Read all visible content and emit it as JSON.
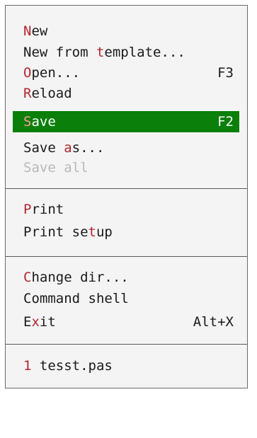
{
  "menu": {
    "groups": [
      {
        "items": [
          {
            "hot": "N",
            "rest": "ew",
            "shortcut": ""
          },
          {
            "pre": "New from ",
            "hot": "t",
            "rest": "emplate...",
            "shortcut": ""
          },
          {
            "hot": "O",
            "rest": "pen...",
            "shortcut": "F3"
          },
          {
            "hot": "R",
            "rest": "eload",
            "shortcut": ""
          },
          {
            "hot": "S",
            "rest": "ave",
            "shortcut": "F2",
            "state": "selected"
          },
          {
            "pre": "Save ",
            "hot": "a",
            "rest": "s...",
            "shortcut": ""
          },
          {
            "pre": "Save a",
            "hot": "l",
            "rest": "l",
            "shortcut": "",
            "state": "disabled"
          }
        ]
      },
      {
        "items": [
          {
            "hot": "P",
            "rest": "rint",
            "shortcut": ""
          },
          {
            "pre": "Print se",
            "hot": "t",
            "rest": "up",
            "shortcut": ""
          }
        ]
      },
      {
        "items": [
          {
            "hot": "C",
            "rest": "hange dir...",
            "shortcut": ""
          },
          {
            "pre": "Command",
            "hot": " ",
            "rest": "shell",
            "shortcut": ""
          },
          {
            "pre": "E",
            "hot": "x",
            "rest": "it",
            "shortcut": "Alt+X"
          }
        ]
      },
      {
        "items": [
          {
            "hot": "1",
            "rest": " tesst.pas",
            "shortcut": ""
          }
        ]
      }
    ],
    "colors": {
      "background": "#f4f4f4",
      "hotkey": "#b3262e",
      "selected_bg": "#0a7f0a",
      "selected_text": "#ffffff",
      "disabled_text": "#b8b8b8"
    }
  }
}
